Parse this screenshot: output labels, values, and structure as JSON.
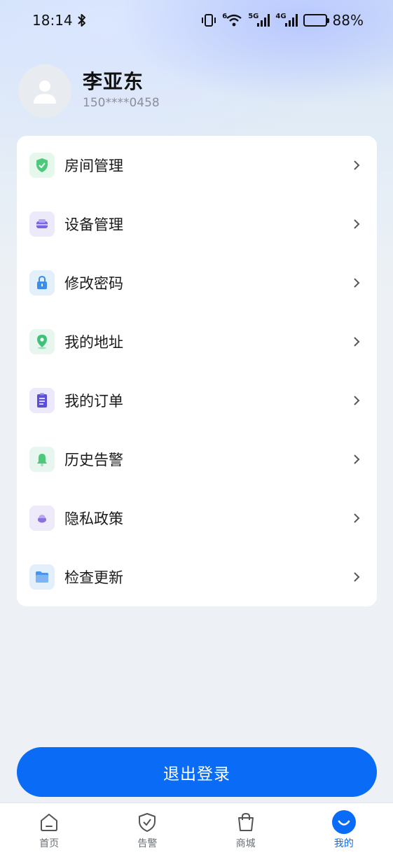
{
  "status_bar": {
    "time": "18:14",
    "battery_percent": "88%",
    "net_5g": "5G",
    "net_4g": "4G",
    "wifi_tag": "6"
  },
  "profile": {
    "name": "李亚东",
    "phone": "150****0458"
  },
  "menu": {
    "items": [
      {
        "label": "房间管理",
        "icon": "shield-check-icon"
      },
      {
        "label": "设备管理",
        "icon": "device-icon"
      },
      {
        "label": "修改密码",
        "icon": "lock-icon"
      },
      {
        "label": "我的地址",
        "icon": "location-pin-icon"
      },
      {
        "label": "我的订单",
        "icon": "clipboard-icon"
      },
      {
        "label": "历史告警",
        "icon": "bell-icon"
      },
      {
        "label": "隐私政策",
        "icon": "privacy-icon"
      },
      {
        "label": "检查更新",
        "icon": "folder-icon"
      }
    ]
  },
  "logout": {
    "label": "退出登录"
  },
  "tab_bar": {
    "tabs": [
      {
        "label": "首页",
        "icon": "home-icon"
      },
      {
        "label": "告警",
        "icon": "shield-icon"
      },
      {
        "label": "商城",
        "icon": "shopping-bag-icon"
      },
      {
        "label": "我的",
        "icon": "profile-smile-icon"
      }
    ],
    "active_index": 3
  },
  "colors": {
    "accent": "#0a6cf6",
    "text_primary": "#1a1a1a",
    "text_secondary": "#8a8f99"
  }
}
